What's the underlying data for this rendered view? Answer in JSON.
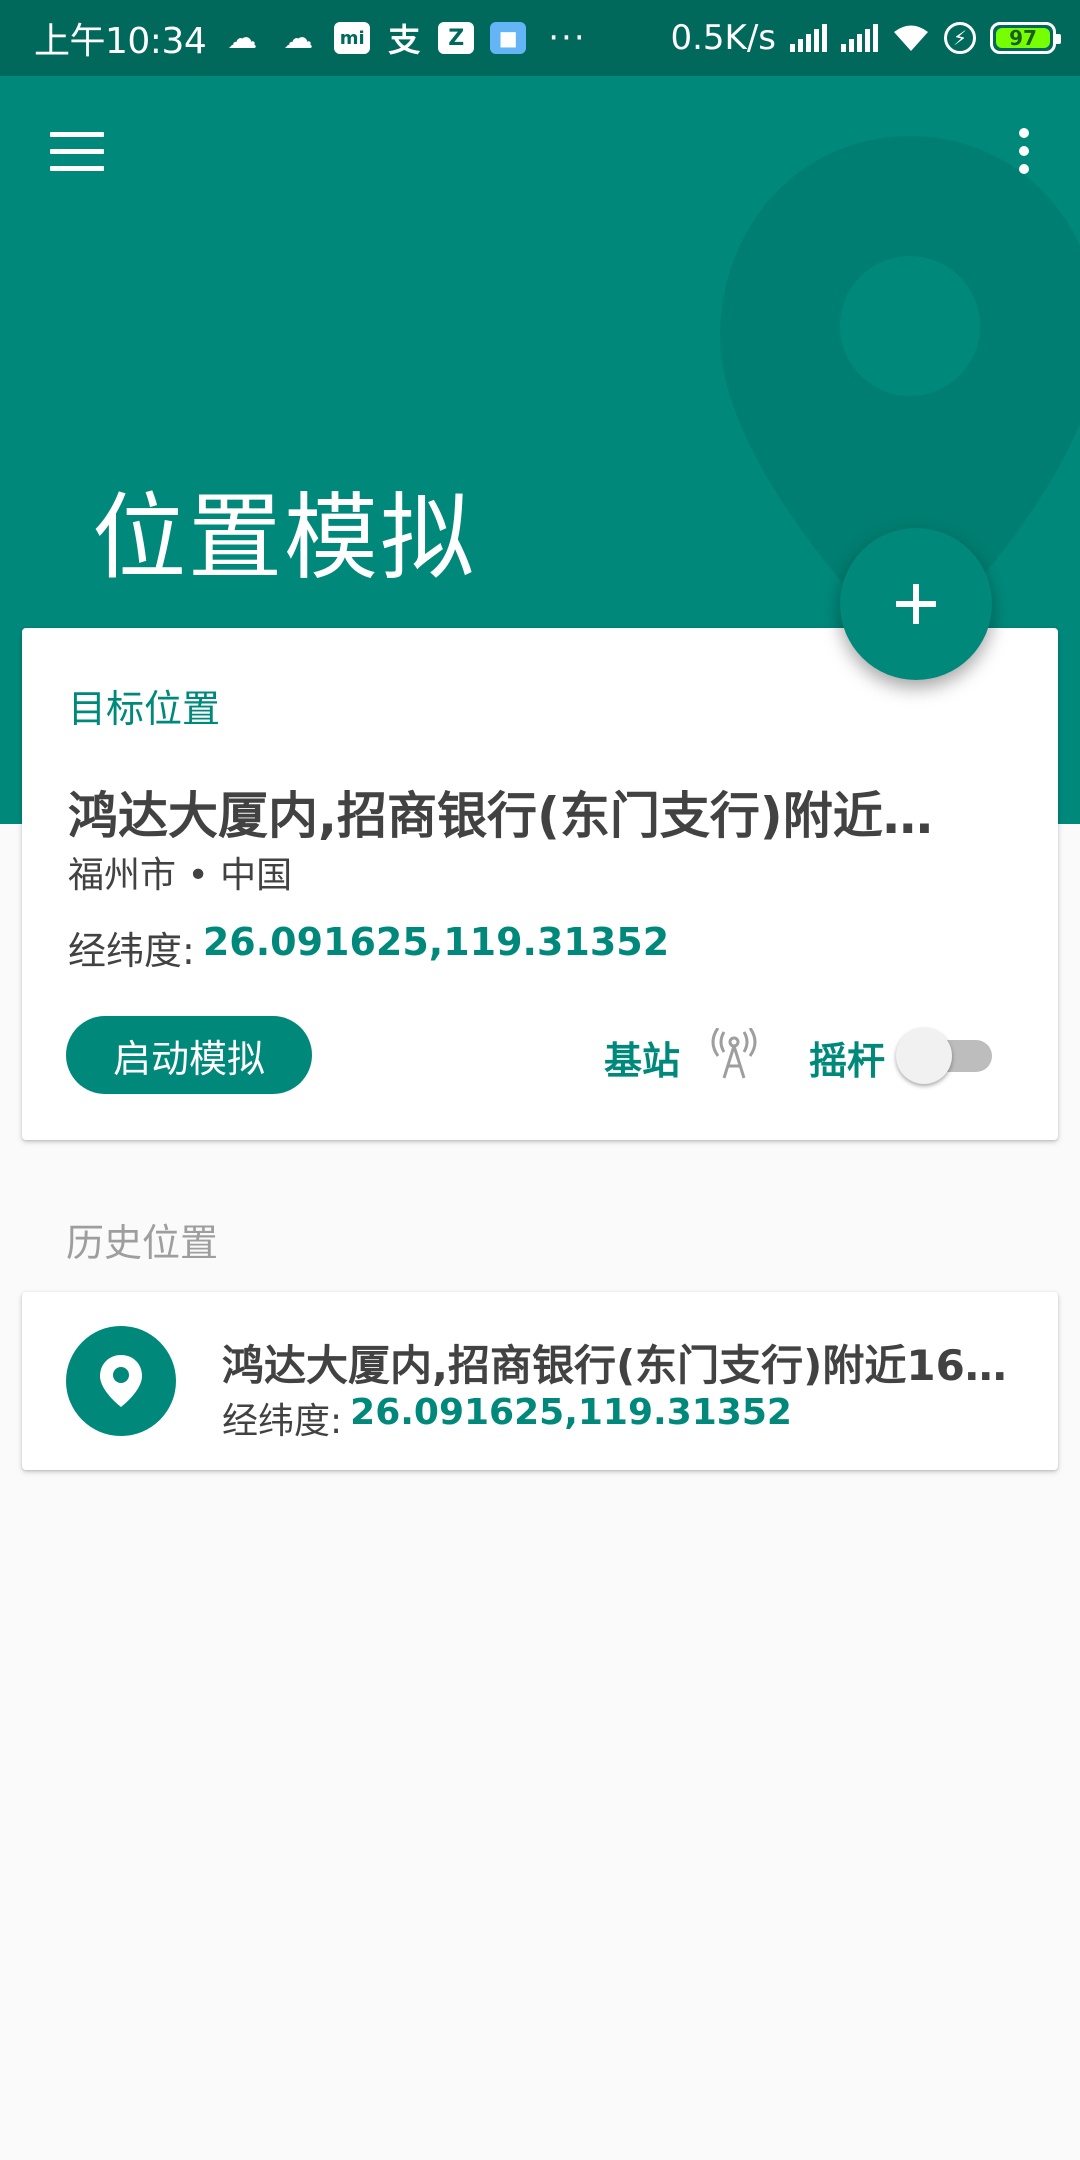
{
  "status_bar": {
    "time": "上午10:34",
    "network_speed": "0.5K/s",
    "battery": "97",
    "notification_icons": [
      "wechat-icon",
      "wechat-icon",
      "mi-store-icon",
      "alipay-icon",
      "z-app-icon",
      "blue-app-icon"
    ],
    "more": "···"
  },
  "header": {
    "title": "位置模拟"
  },
  "fab": {
    "label": "+"
  },
  "target_card": {
    "section_label": "目标位置",
    "address": "鸿达大厦内,招商银行(东门支行)附近…",
    "region": "福州市 • 中国",
    "coord_label": "经纬度:",
    "coord_value": "26.091625,119.31352",
    "start_button": "启动模拟",
    "cell_label": "基站",
    "joystick_label": "摇杆",
    "joystick_enabled": false
  },
  "history": {
    "section_label": "历史位置",
    "items": [
      {
        "title": "鸿达大厦内,招商银行(东门支行)附近16…",
        "coord_label": "经纬度:",
        "coord_value": "26.091625,119.31352"
      }
    ]
  },
  "colors": {
    "primary": "#00897b",
    "primary_dark": "#00695c",
    "background": "#fafafa"
  }
}
